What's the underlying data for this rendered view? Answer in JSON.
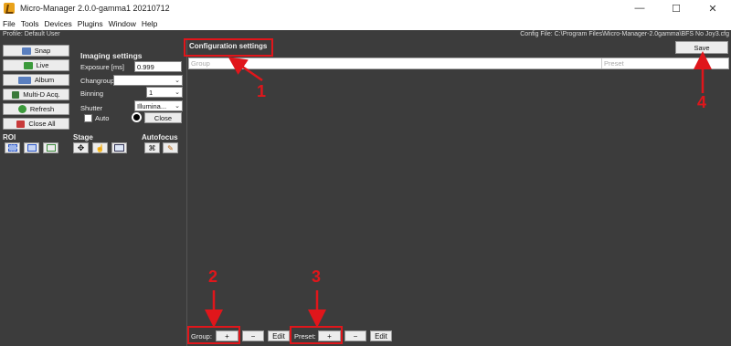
{
  "window": {
    "title": "Micro-Manager 2.0.0-gamma1 20210712",
    "minimize_glyph": "—",
    "maximize_glyph": "☐",
    "close_glyph": "✕"
  },
  "menu": [
    "File",
    "Tools",
    "Devices",
    "Plugins",
    "Window",
    "Help"
  ],
  "profile": {
    "label": "Profile: Default User",
    "config_file": "Config File: C:\\Program Files\\Micro-Manager-2.0gamma\\BFS No Joy3.cfg"
  },
  "buttons": {
    "snap": "Snap",
    "live": "Live",
    "album": "Album",
    "mda": "Multi-D Acq.",
    "refresh": "Refresh",
    "close_all": "Close All"
  },
  "imaging": {
    "title": "Imaging settings",
    "exposure_label": "Exposure [ms]",
    "exposure_value": "0.999",
    "changroup_label": "Changroup",
    "changroup_value": "",
    "binning_label": "Binning",
    "binning_value": "1",
    "shutter_label": "Shutter",
    "shutter_value": "Illumina...",
    "auto_label": "Auto",
    "close_label": "Close"
  },
  "sections": {
    "roi": "ROI",
    "stage": "Stage",
    "autofocus": "Autofocus"
  },
  "config": {
    "title": "Configuration settings",
    "save": "Save",
    "col_group": "Group",
    "col_preset": "Preset",
    "group_label": "Group:",
    "preset_label": "Preset:",
    "add": "+",
    "remove": "−",
    "edit": "Edit"
  },
  "annotations": [
    "1",
    "2",
    "3",
    "4"
  ],
  "colors": {
    "panel_bg": "#3c3c3c",
    "annotation_red": "#e0161b"
  }
}
